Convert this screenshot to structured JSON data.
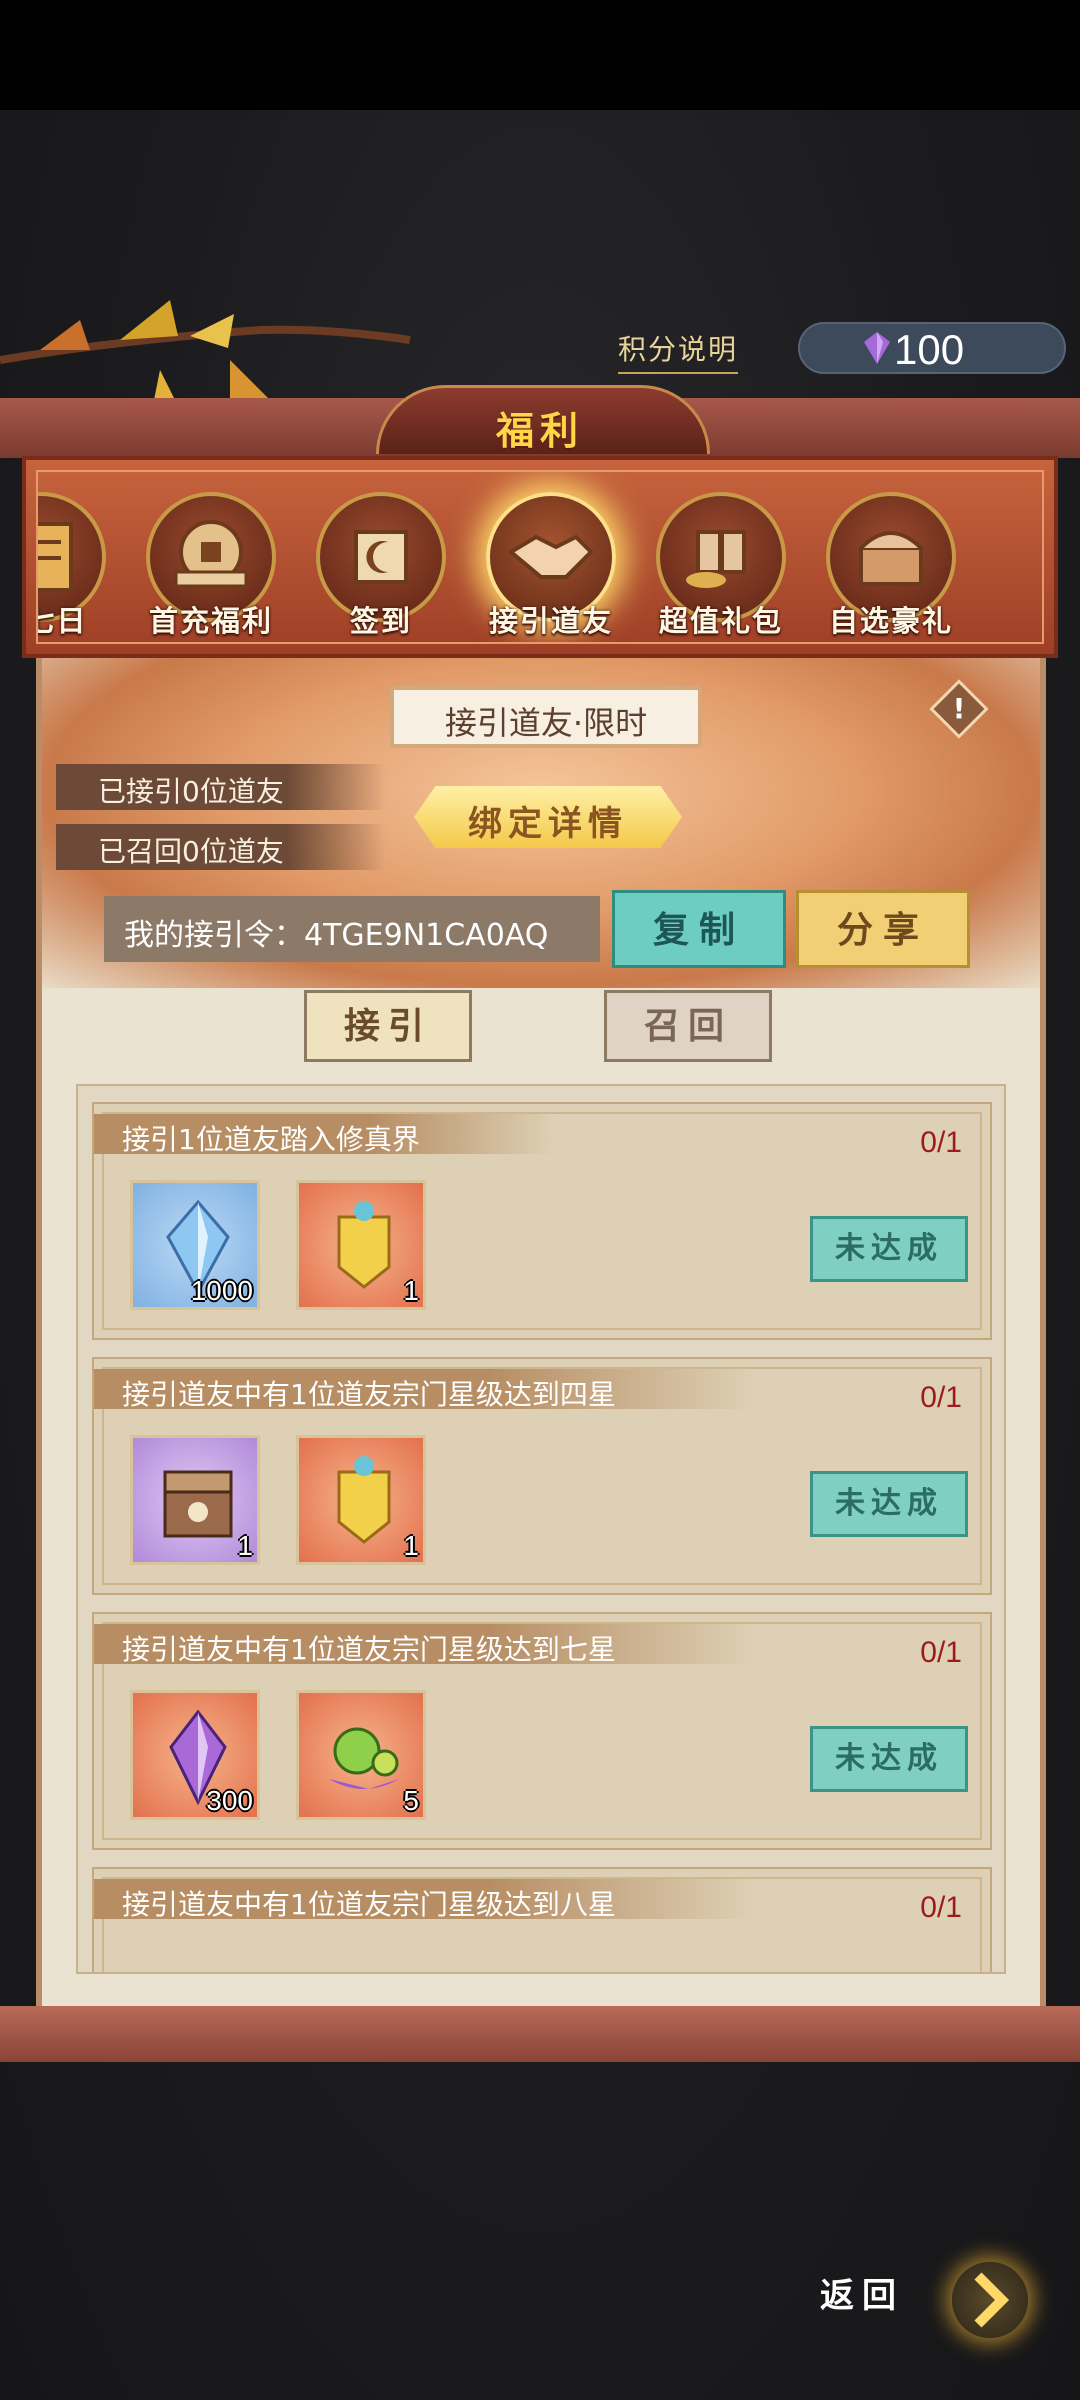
{
  "header": {
    "points_link": "积分说明",
    "points_value": "100",
    "title": "福利"
  },
  "tabs": [
    {
      "label": "豪七日",
      "icon": "scroll-icon"
    },
    {
      "label": "首充福利",
      "icon": "coin-icon"
    },
    {
      "label": "签到",
      "icon": "moon-scroll-icon"
    },
    {
      "label": "接引道友",
      "icon": "handshake-icon",
      "active": true
    },
    {
      "label": "超值礼包",
      "icon": "giftbox-icon"
    },
    {
      "label": "自选豪礼",
      "icon": "chest-icon"
    }
  ],
  "hero": {
    "title": "接引道友·限时",
    "info": "!",
    "invited_count_text": "已接引0位道友",
    "recalled_count_text": "已召回0位道友",
    "bind_button": "绑定详情",
    "code_label": "我的接引令：",
    "code_value": "4TGE9N1CA0AQ",
    "copy_button": "复制",
    "share_button": "分享"
  },
  "segments": {
    "invite": "接引",
    "recall": "召回"
  },
  "tasks": [
    {
      "title": "接引1位道友踏入修真界",
      "progress": "0/1",
      "status": "未达成",
      "items": [
        {
          "icon": "blue-crystal-icon",
          "qty": "1000"
        },
        {
          "icon": "golden-talisman-icon",
          "qty": "1"
        }
      ]
    },
    {
      "title": "接引道友中有1位道友宗门星级达到四星",
      "progress": "0/1",
      "status": "未达成",
      "items": [
        {
          "icon": "treasure-chest-icon",
          "qty": "1"
        },
        {
          "icon": "golden-talisman-icon",
          "qty": "1"
        }
      ]
    },
    {
      "title": "接引道友中有1位道友宗门星级达到七星",
      "progress": "0/1",
      "status": "未达成",
      "items": [
        {
          "icon": "purple-crystal-icon",
          "qty": "300"
        },
        {
          "icon": "spirit-fruit-icon",
          "qty": "5"
        }
      ]
    },
    {
      "title": "接引道友中有1位道友宗门星级达到八星",
      "progress": "0/1",
      "status": "",
      "items": []
    }
  ],
  "footer": {
    "back_label": "返回"
  }
}
